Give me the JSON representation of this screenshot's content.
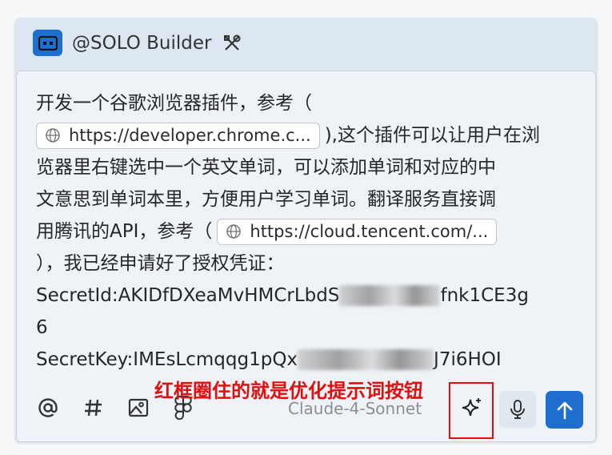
{
  "header": {
    "agent_name": "@SOLO Builder",
    "agent_icon": "agent-face-icon",
    "tool_icon": "tools-icon",
    "accent": "#1f6fd1"
  },
  "input": {
    "line1": "开发一个谷歌浏览器插件，参考（",
    "link1": "https://developer.chrome.c...",
    "line2_tail": "),这个插件可以让用户在浏",
    "line3": "览器里右键选中一个英文单词，可以添加单词和对应的中",
    "line4": "文意思到单词本里，方便用户学习单词。翻译服务直接调",
    "line5": "用腾讯的API，参考（",
    "link2": "https://cloud.tencent.com/...",
    "line6": "），我已经申请好了授权凭证：",
    "secret_id_prefix": "SecretId:AKIDfDXeaMvHMCrLbdS",
    "secret_id_suffix": "fnk1CE3g",
    "secret_id_last": "6",
    "secret_key_prefix": "SecretKey:IMEsLcmqqg1pQx",
    "secret_key_suffix": "J7i6HOI"
  },
  "toolbar": {
    "mention_icon": "at-icon",
    "hash_icon": "hash-icon",
    "image_icon": "image-icon",
    "figma_icon": "figma-icon",
    "model": "Claude-4-Sonnet",
    "sparkle_icon": "sparkle-icon",
    "mic_icon": "microphone-icon",
    "send_icon": "arrow-up-icon"
  },
  "annotation": {
    "text": "红框圈住的就是优化提示词按钮",
    "color": "#e01010"
  }
}
